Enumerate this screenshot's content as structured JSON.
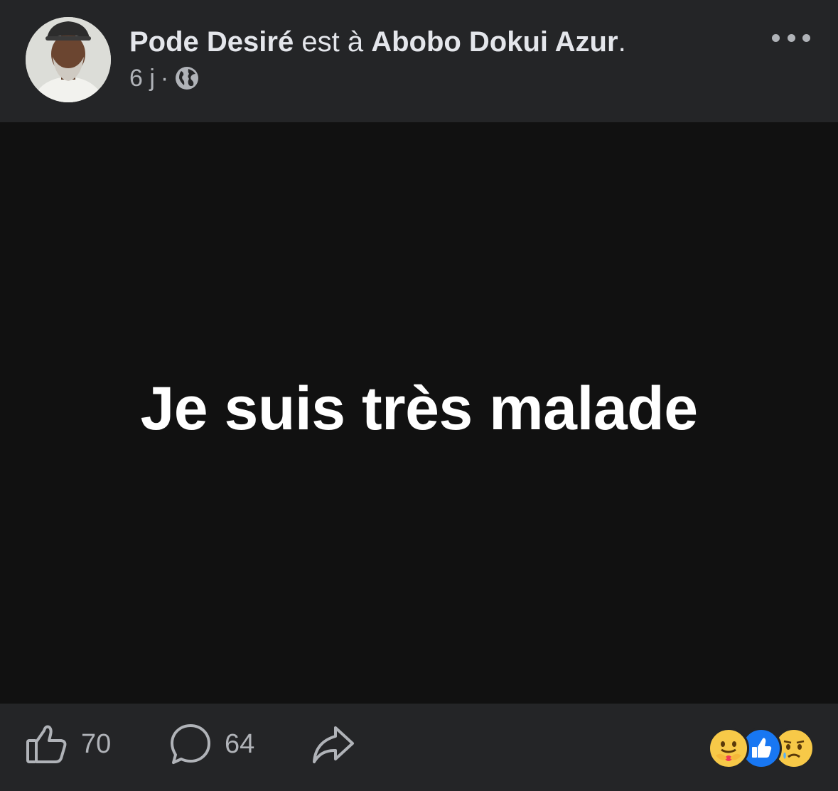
{
  "post": {
    "author": "Pode Desiré",
    "location_connector": "est à",
    "location": "Abobo Dokui Azur",
    "location_suffix": ".",
    "timestamp": "6 j",
    "separator": "·",
    "audience_icon": "globe-icon",
    "more_icon": "more-options-icon",
    "body_text": "Je suis très malade",
    "body_background": "#111111"
  },
  "footer": {
    "like_count": "70",
    "comment_count": "64",
    "like_icon": "thumbs-up-icon",
    "comment_icon": "comment-bubble-icon",
    "share_icon": "share-arrow-icon",
    "reactions": [
      "care-reaction-icon",
      "like-reaction-icon",
      "sad-reaction-icon"
    ]
  },
  "colors": {
    "background": "#242527",
    "text": "#e4e6eb",
    "secondary_text": "#b0b3b8",
    "like_blue": "#1877f2"
  }
}
